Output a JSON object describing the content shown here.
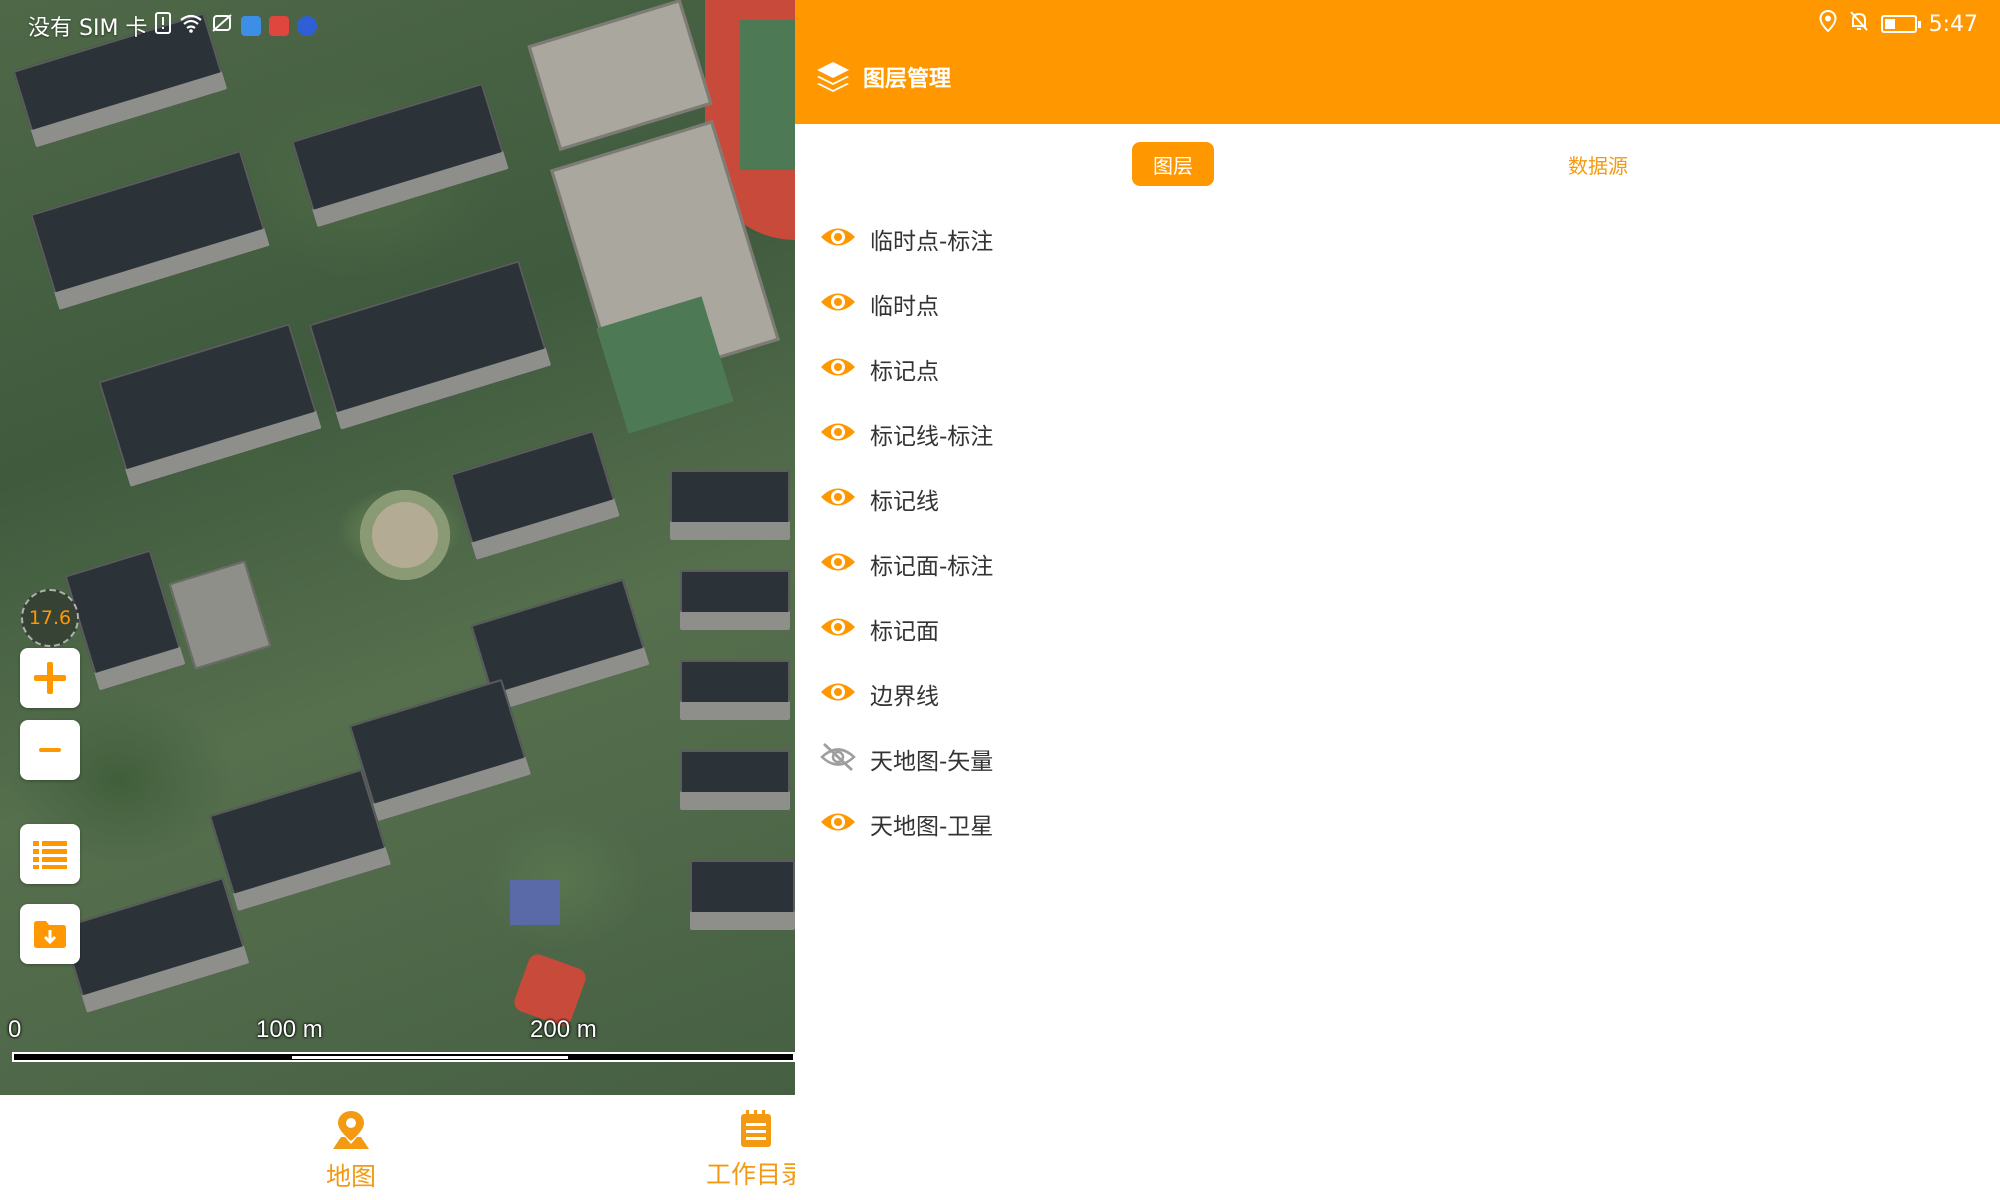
{
  "status_bar": {
    "carrier_text": "没有 SIM 卡",
    "time": "5:47",
    "icons_left": [
      "sim-alert-icon",
      "wifi-icon",
      "vpn-icon",
      "app-icon-blue",
      "app-icon-red",
      "app-icon-bulb"
    ],
    "icons_right": [
      "location-icon",
      "bell-off-icon",
      "battery-icon"
    ]
  },
  "map": {
    "zoom_level": "17.6",
    "controls": [
      "zoom-in-icon",
      "zoom-out-icon",
      "layer-list-icon",
      "folder-download-icon"
    ],
    "scale": {
      "labels": [
        "0",
        "100 m",
        "200 m"
      ]
    }
  },
  "bottom_nav": {
    "items": [
      {
        "label": "地图",
        "icon": "map-pin-icon"
      },
      {
        "label": "工作目录",
        "icon": "clipboard-icon"
      }
    ]
  },
  "panel": {
    "title": "图层管理",
    "title_icon": "layers-icon",
    "tabs": [
      {
        "label": "图层",
        "active": true
      },
      {
        "label": "数据源",
        "active": false
      }
    ],
    "layers": [
      {
        "name": "临时点-标注",
        "visible": true
      },
      {
        "name": "临时点",
        "visible": true
      },
      {
        "name": "标记点",
        "visible": true
      },
      {
        "name": "标记线-标注",
        "visible": true
      },
      {
        "name": "标记线",
        "visible": true
      },
      {
        "name": "标记面-标注",
        "visible": true
      },
      {
        "name": "标记面",
        "visible": true
      },
      {
        "name": "边界线",
        "visible": true
      },
      {
        "name": "天地图-矢量",
        "visible": false
      },
      {
        "name": "天地图-卫星",
        "visible": true
      }
    ]
  },
  "colors": {
    "accent": "#ff9800",
    "text": "#333333",
    "icon_hidden": "#9e9e9e"
  }
}
